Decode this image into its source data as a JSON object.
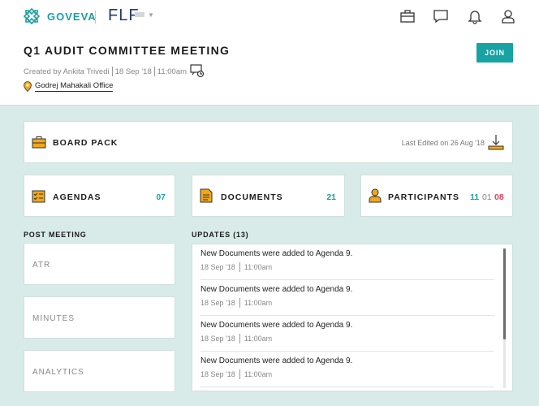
{
  "header": {
    "brand": "GOVEVA",
    "client": "FLF",
    "title": "Q1 AUDIT COMMITTEE MEETING",
    "created_by": "Created by Ankita Trivedi",
    "date": "18 Sep '18",
    "time": "11:00am",
    "location": "Godrej Mahakali Office",
    "join_label": "JOIN",
    "icons": [
      "briefcase-icon",
      "chat-icon",
      "bell-icon",
      "user-icon"
    ]
  },
  "board_pack": {
    "label": "BOARD PACK",
    "last_edited": "Last Edited on 26 Aug '18"
  },
  "agendas": {
    "label": "AGENDAS",
    "count": "07"
  },
  "documents": {
    "label": "DOCUMENTS",
    "count": "21"
  },
  "participants": {
    "label": "PARTICIPANTS",
    "c1": "11",
    "c2": "01",
    "c3": "08"
  },
  "post_meeting": {
    "label": "POST MEETING",
    "items": [
      "ATR",
      "MINUTES",
      "ANALYTICS"
    ]
  },
  "updates": {
    "label": "UPDATES (13)",
    "items": [
      {
        "text": "New Documents were added to Agenda 9.",
        "date": "18 Sep '18",
        "time": "11:00am"
      },
      {
        "text": "New Documents were added to Agenda 9.",
        "date": "18 Sep '18",
        "time": "11:00am"
      },
      {
        "text": "New Documents were added to Agenda 9.",
        "date": "18 Sep '18",
        "time": "11:00am"
      },
      {
        "text": "New Documents were added to Agenda 9.",
        "date": "18 Sep '18",
        "time": "11:00am"
      }
    ]
  },
  "colors": {
    "accent": "#17a2a3",
    "icon": "#f2a71b",
    "red": "#e0435a",
    "background": "#d8ebe8"
  }
}
